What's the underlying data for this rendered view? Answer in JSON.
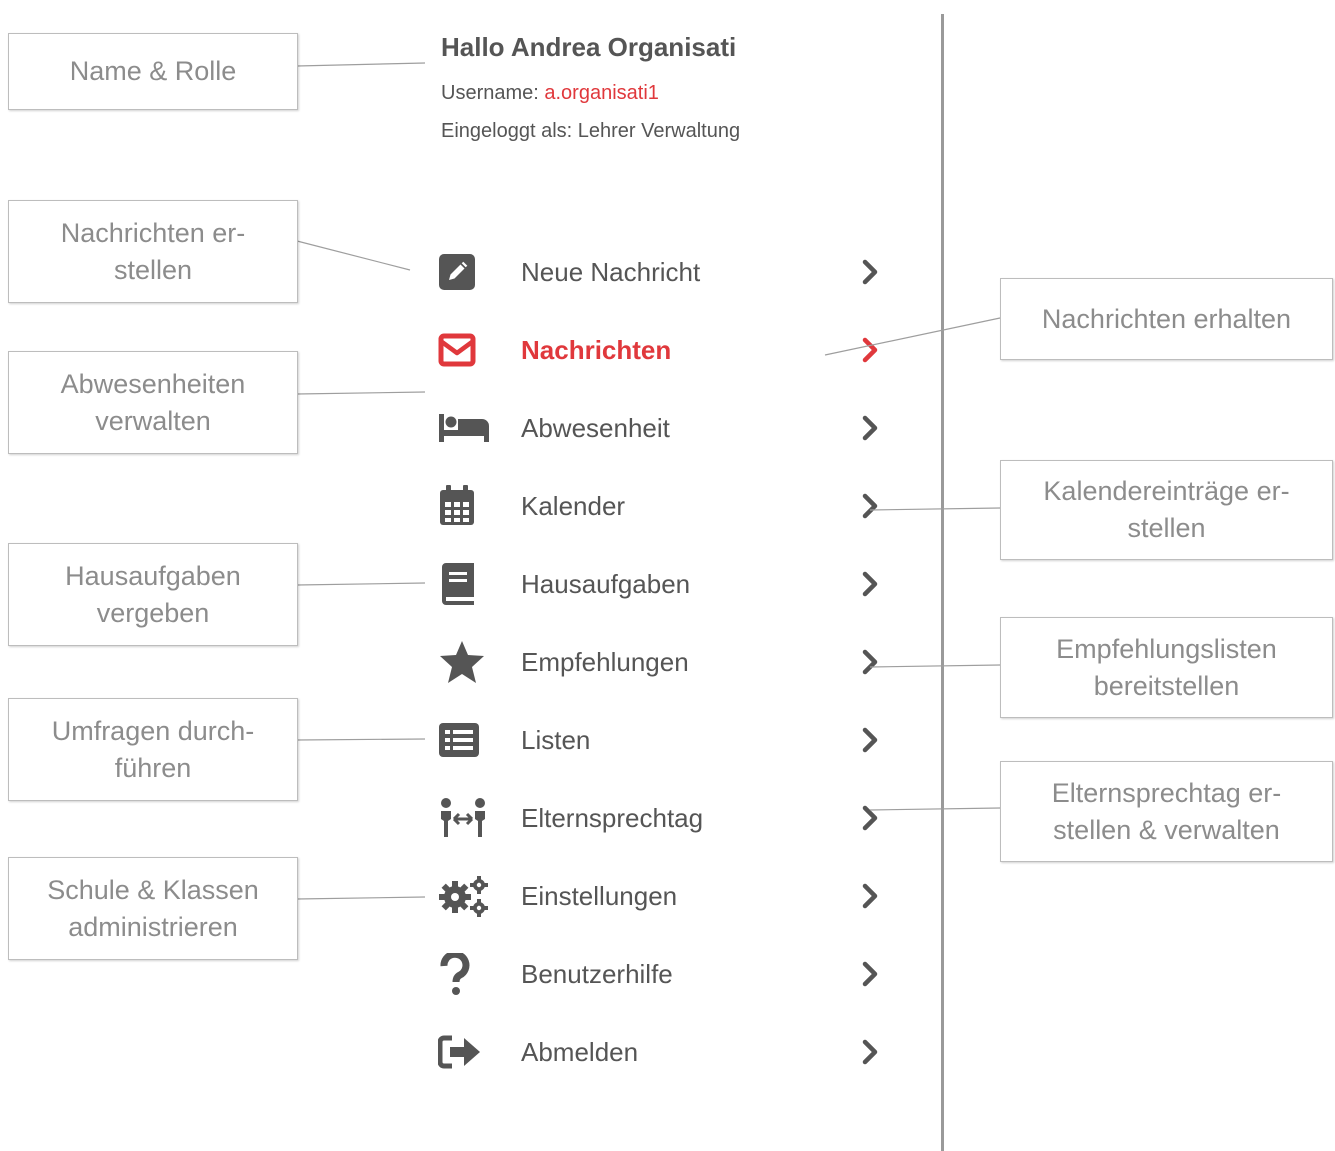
{
  "header": {
    "greeting": "Hallo Andrea Organisati",
    "username_label": "Username: ",
    "username_value": "a.organisati1",
    "logged_in_as": "Eingeloggt als: Lehrer Verwaltung"
  },
  "menu": {
    "items": [
      {
        "label": "Neue Nachricht",
        "icon": "edit-icon"
      },
      {
        "label": "Nachrichten",
        "icon": "envelope-icon",
        "active": true
      },
      {
        "label": "Abwesenheit",
        "icon": "bed-icon"
      },
      {
        "label": "Kalender",
        "icon": "calendar-icon"
      },
      {
        "label": "Hausaufgaben",
        "icon": "book-icon"
      },
      {
        "label": "Empfehlungen",
        "icon": "star-icon"
      },
      {
        "label": "Listen",
        "icon": "list-icon"
      },
      {
        "label": "Elternsprechtag",
        "icon": "people-arrows-icon"
      },
      {
        "label": "Einstellungen",
        "icon": "gears-icon"
      },
      {
        "label": "Benutzerhilfe",
        "icon": "question-icon"
      },
      {
        "label": "Abmelden",
        "icon": "sign-out-icon"
      }
    ]
  },
  "callouts": {
    "left": [
      "Name & Rolle",
      "Nachrichten er-\nstellen",
      "Abwesenheiten\nverwalten",
      "Hausaufgaben\nvergeben",
      "Umfragen durch-\nführen",
      "Schule & Klassen\nadministrieren"
    ],
    "right": [
      "Nachrichten erhalten",
      "Kalendereinträge er-\nstellen",
      "Empfehlungslisten\nbereitstellen",
      "Elternsprechtag er-\nstellen & verwalten"
    ]
  },
  "colors": {
    "accent": "#e0383c",
    "text": "#555555",
    "callout_text": "#8c8c8c",
    "icon": "#555555"
  }
}
